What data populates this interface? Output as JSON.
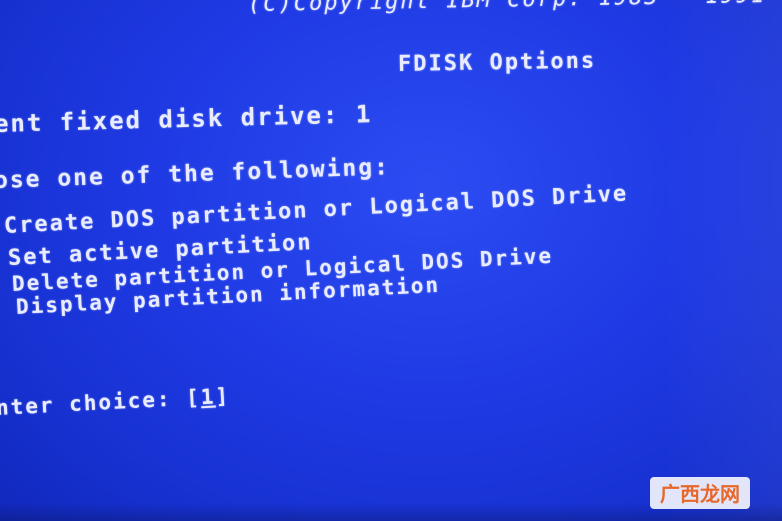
{
  "header": {
    "copyright": "(C)Copyright IBM Corp. 1983 - 1991",
    "title": "FDISK Options"
  },
  "drive": {
    "label": "ent fixed disk drive: 1"
  },
  "prompt": {
    "text": "ose one of the following:"
  },
  "menu": {
    "items": [
      {
        "label": "Create DOS partition or Logical DOS Drive"
      },
      {
        "label": "Set active partition"
      },
      {
        "label": "Delete partition or Logical DOS Drive"
      },
      {
        "label": "Display partition information"
      }
    ]
  },
  "choice": {
    "label": "nter choice: ",
    "value": "1"
  },
  "watermark": {
    "text": "广西龙网"
  },
  "colors": {
    "background": "#1f3ae4",
    "text": "#e9ecff",
    "watermark": "#e8682a"
  }
}
